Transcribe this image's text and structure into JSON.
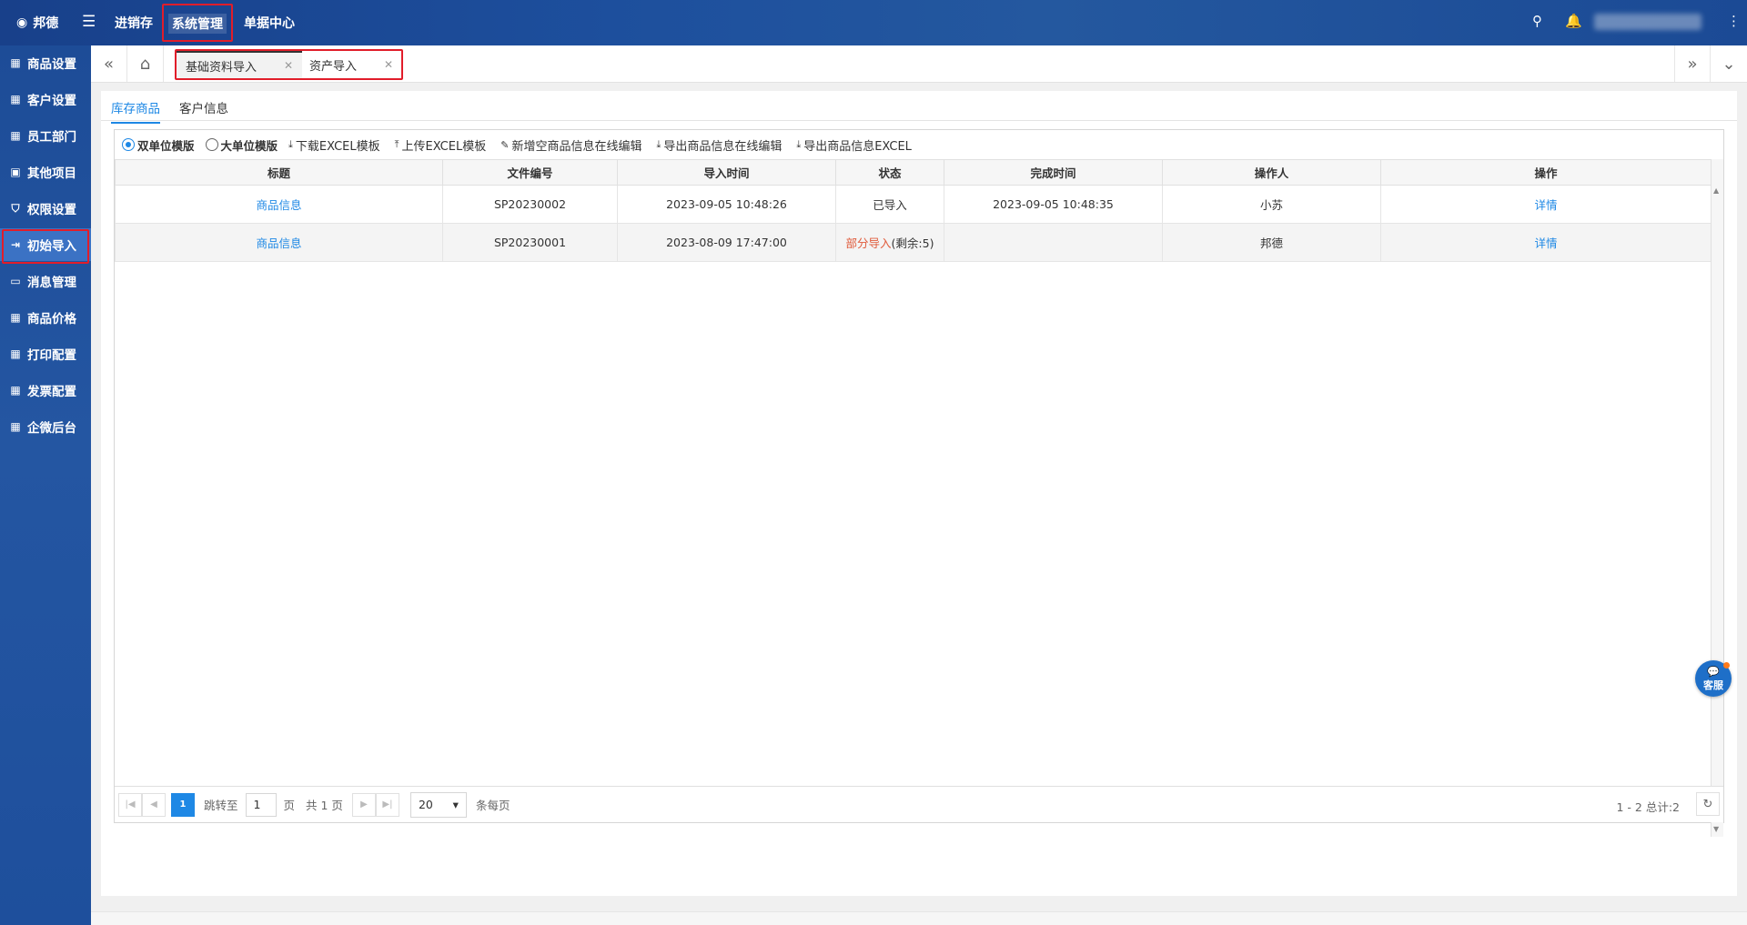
{
  "topbar": {
    "brand": "邦德",
    "nav": [
      "进销存",
      "系统管理",
      "单据中心"
    ],
    "active_nav": "系统管理"
  },
  "sidebar": {
    "items": [
      {
        "label": "商品设置",
        "icon": "grid-icon"
      },
      {
        "label": "客户设置",
        "icon": "grid-icon"
      },
      {
        "label": "员工部门",
        "icon": "grid-icon"
      },
      {
        "label": "其他项目",
        "icon": "folder-icon"
      },
      {
        "label": "权限设置",
        "icon": "shield-icon"
      },
      {
        "label": "初始导入",
        "icon": "import-icon"
      },
      {
        "label": "消息管理",
        "icon": "message-icon"
      },
      {
        "label": "商品价格",
        "icon": "grid-icon"
      },
      {
        "label": "打印配置",
        "icon": "grid-icon"
      },
      {
        "label": "发票配置",
        "icon": "grid-icon"
      },
      {
        "label": "企微后台",
        "icon": "grid-icon"
      }
    ],
    "active": "初始导入"
  },
  "tabs": [
    {
      "label": "基础资料导入",
      "current": true
    },
    {
      "label": "资产导入",
      "current": false
    }
  ],
  "subtabs": {
    "items": [
      "库存商品",
      "客户信息"
    ],
    "active": "库存商品"
  },
  "toolbar": {
    "radio_double": "双单位模版",
    "radio_big": "大单位模版",
    "download_template": "下载EXCEL模板",
    "upload_template": "上传EXCEL模板",
    "new_online_edit": "新增空商品信息在线编辑",
    "export_online_edit": "导出商品信息在线编辑",
    "export_excel": "导出商品信息EXCEL"
  },
  "table": {
    "columns": [
      "标题",
      "文件编号",
      "导入时间",
      "状态",
      "完成时间",
      "操作人",
      "操作"
    ],
    "rows": [
      {
        "title": "商品信息",
        "file_no": "SP20230002",
        "import_time": "2023-09-05 10:48:26",
        "status": "已导入",
        "status_extra": "",
        "finish_time": "2023-09-05 10:48:35",
        "operator": "小苏",
        "action": "详情"
      },
      {
        "title": "商品信息",
        "file_no": "SP20230001",
        "import_time": "2023-08-09 17:47:00",
        "status": "部分导入",
        "status_extra": "(剩余:5)",
        "finish_time": "",
        "operator": "邦德",
        "action": "详情"
      }
    ]
  },
  "pager": {
    "current_page": "1",
    "jump_label": "跳转至",
    "jump_value": "1",
    "page_unit": "页",
    "total_pages": "共 1 页",
    "page_size": "20",
    "per_page_label": "条每页",
    "summary": "1 - 2 总计:2"
  },
  "service": {
    "label": "客服"
  }
}
